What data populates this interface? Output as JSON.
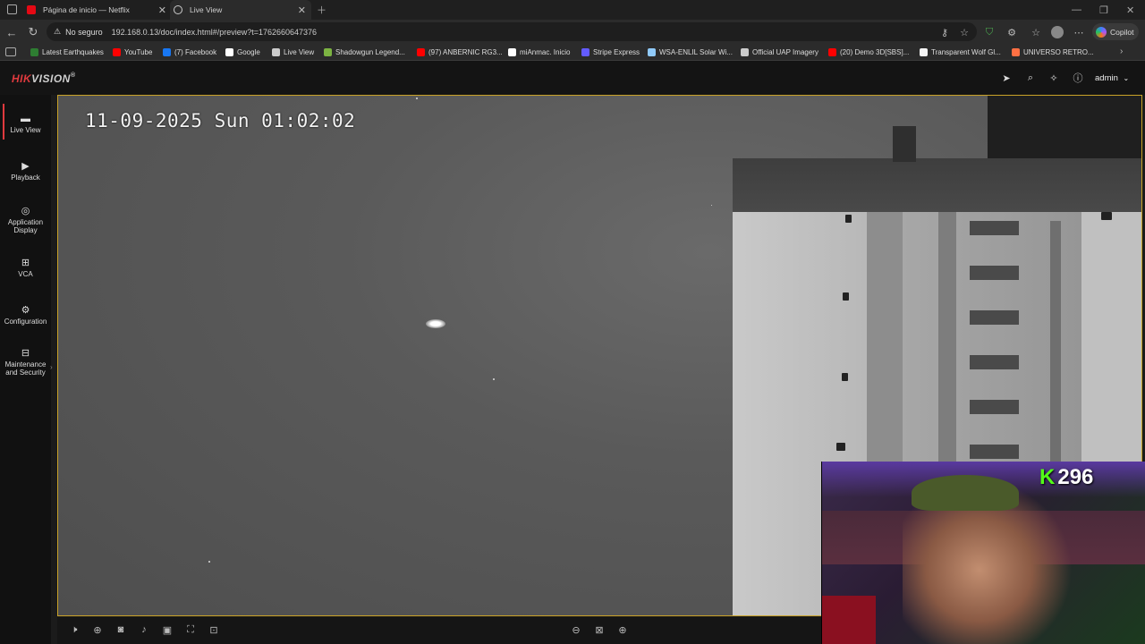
{
  "browser": {
    "tabs": [
      {
        "label": "Página de inicio — Netflix",
        "color": "#e50914"
      },
      {
        "label": "Live View",
        "color": "#cccccc"
      }
    ],
    "security_label": "No seguro",
    "url": "192.168.0.13/doc/index.html#/preview?t=1762660647376",
    "copilot_label": "Copilot",
    "bookmarks": [
      {
        "label": "Latest Earthquakes",
        "color": "#2e7d32"
      },
      {
        "label": "YouTube",
        "color": "#ff0000"
      },
      {
        "label": "(7) Facebook",
        "color": "#1877f2"
      },
      {
        "label": "Google",
        "color": "#ffffff"
      },
      {
        "label": "Live View",
        "color": "#cccccc"
      },
      {
        "label": "Shadowgun Legend...",
        "color": "#7cb342"
      },
      {
        "label": "(97) ANBERNIC RG3...",
        "color": "#ff0000"
      },
      {
        "label": "miAnmac. Inicio",
        "color": "#ffffff"
      },
      {
        "label": "Stripe Express",
        "color": "#635bff"
      },
      {
        "label": "WSA-ENLIL Solar Wi...",
        "color": "#90caf9"
      },
      {
        "label": "Official UAP Imagery",
        "color": "#cccccc"
      },
      {
        "label": "(20) Demo 3D[SBS]...",
        "color": "#ff0000"
      },
      {
        "label": "Transparent Wolf Gl...",
        "color": "#f5f5f5"
      },
      {
        "label": "UNIVERSO RETRO...",
        "color": "#ff7043"
      }
    ]
  },
  "app": {
    "brand_a": "HIK",
    "brand_b": "VISION",
    "brand_mark": "®",
    "brand_color": "#e03a3e",
    "user": "admin",
    "nav": [
      {
        "label": "Live View",
        "icon": "live-view-icon"
      },
      {
        "label": "Playback",
        "icon": "playback-icon"
      },
      {
        "label": "Application Display",
        "icon": "application-icon"
      },
      {
        "label": "VCA",
        "icon": "vca-icon"
      },
      {
        "label": "Configuration",
        "icon": "gear-icon"
      },
      {
        "label": "Maintenance and Security",
        "icon": "maintenance-icon"
      }
    ],
    "active_nav": "Live View"
  },
  "video": {
    "osd_timestamp": "11-09-2025 Sun 01:02:02"
  },
  "stream_overlay": {
    "badge_letter": "K",
    "badge_count": "296"
  }
}
